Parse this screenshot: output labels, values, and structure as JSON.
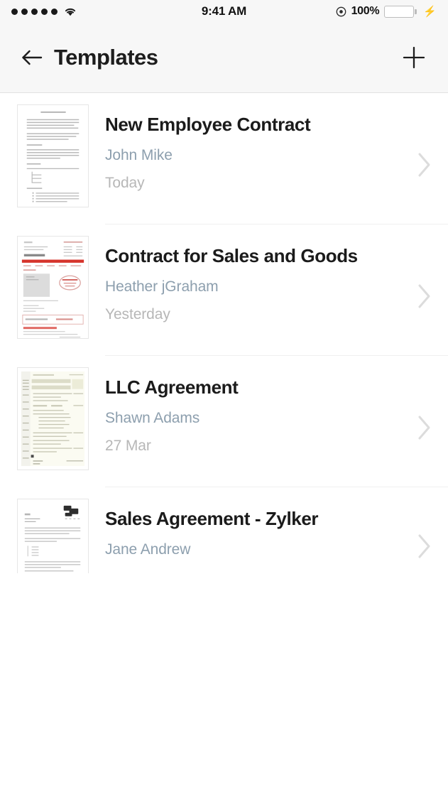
{
  "status_bar": {
    "signal_dots": 5,
    "wifi_icon": "wifi-icon",
    "time": "9:41 AM",
    "location_icon": "location-services-icon",
    "battery_percent": "100%",
    "battery_level": 100,
    "battery_color": "#2ad04b",
    "charging_icon": "lightning-bolt-icon"
  },
  "header": {
    "back_icon": "arrow-left-icon",
    "title": "Templates",
    "add_icon": "plus-icon",
    "background": "#f7f7f7"
  },
  "list": {
    "chevron_icon": "chevron-right-icon",
    "items": [
      {
        "title": "New Employee Contract",
        "author": "John Mike",
        "date": "Today",
        "thumbnail": "document-text-page-thumbnail"
      },
      {
        "title": "Contract for Sales and Goods",
        "author": "Heather jGraham",
        "date": "Yesterday",
        "thumbnail": "invoice-red-header-thumbnail"
      },
      {
        "title": "LLC Agreement",
        "author": "Shawn Adams",
        "date": "27 Mar",
        "thumbnail": "tax-form-yellow-thumbnail"
      },
      {
        "title": "Sales Agreement - Zylker",
        "author": "Jane Andrew",
        "date": "",
        "thumbnail": "letterhead-logo-thumbnail"
      }
    ]
  },
  "colors": {
    "title_text": "#1b1b1b",
    "author_text": "#8d9fae",
    "date_text": "#b7b7b7",
    "divider": "#f0f0f0",
    "accent_red": "#d6342c"
  }
}
